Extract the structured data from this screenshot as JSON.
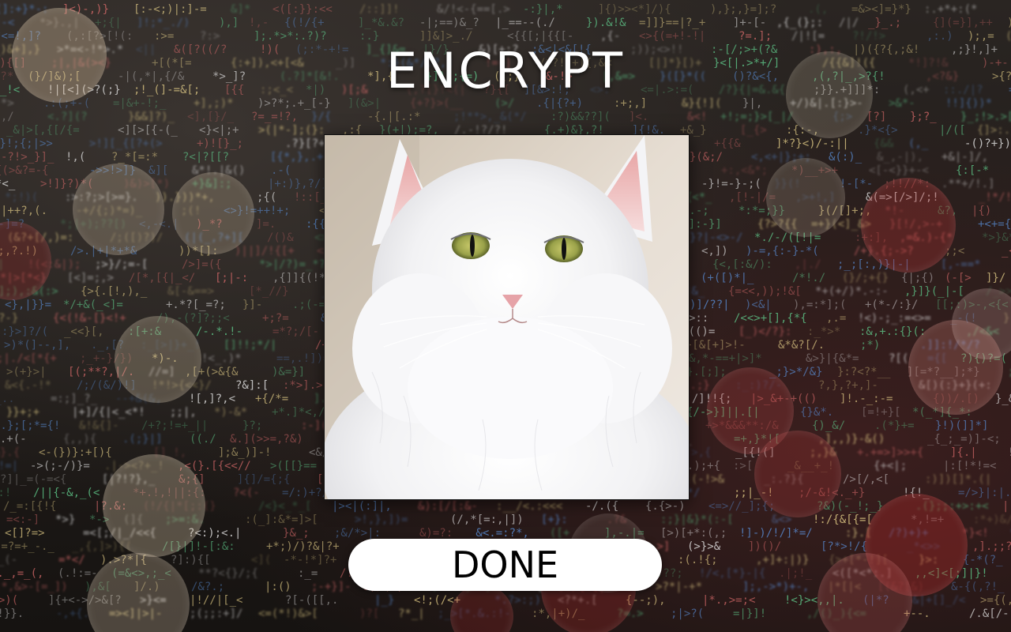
{
  "screen": {
    "title": "ENCRYPT",
    "done_label": "DONE"
  },
  "image": {
    "subject": "white cat"
  },
  "colors": {
    "button_bg": "#ffffff",
    "button_text": "#000000",
    "title_text": "#ffffff",
    "code_yellow": "#e8d28a",
    "code_blue": "#5a8fd8",
    "code_green": "#5fc98a",
    "code_white": "#e8e8e8",
    "code_red": "#d86a6a"
  }
}
